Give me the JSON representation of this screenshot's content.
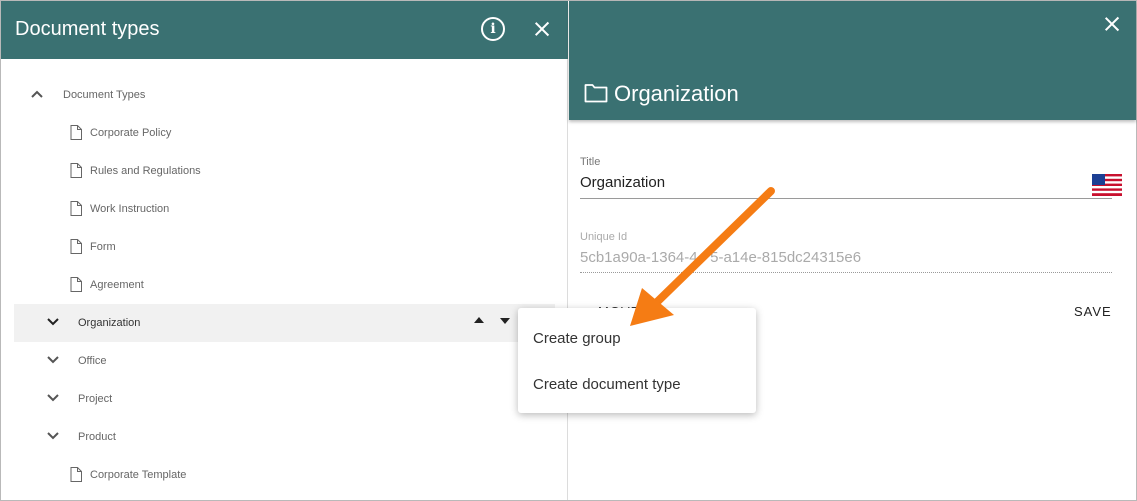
{
  "left_panel": {
    "title": "Document types",
    "tree": {
      "root": "Document Types",
      "root_children": [
        "Corporate Policy",
        "Rules and Regulations",
        "Work Instruction",
        "Form",
        "Agreement"
      ],
      "groups": [
        "Organization",
        "Office",
        "Project",
        "Product"
      ],
      "product_child": "Corporate Template"
    }
  },
  "right_panel": {
    "title": "Organization",
    "fields": {
      "title_label": "Title",
      "title_value": "Organization",
      "uid_label": "Unique Id",
      "uid_value": "5cb1a90a-1364-4   5-a14e-815dc24315e6"
    },
    "buttons": {
      "move_partial": "MOVE",
      "save": "SAVE"
    }
  },
  "menu": {
    "items": [
      "Create group",
      "Create document type"
    ]
  },
  "colors": {
    "header": "#3a7172",
    "arrow": "#f57c14"
  }
}
